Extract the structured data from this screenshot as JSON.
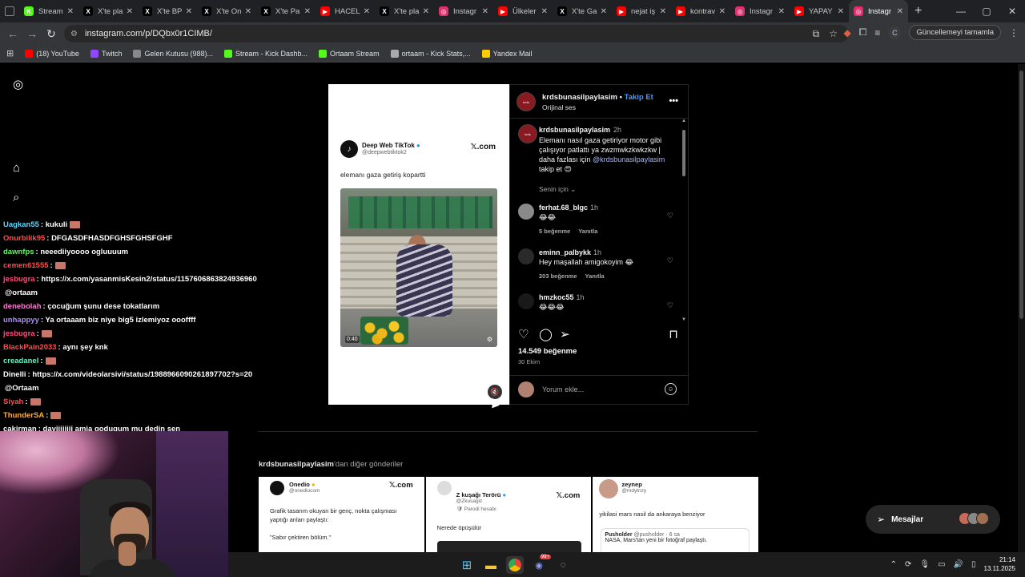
{
  "browser": {
    "tabs": [
      {
        "label": "Stream",
        "color": "#53fc18",
        "glyph": "K"
      },
      {
        "label": "X'te pla",
        "color": "#000000",
        "glyph": "X"
      },
      {
        "label": "X'te BP",
        "color": "#000000",
        "glyph": "X"
      },
      {
        "label": "X'te On",
        "color": "#000000",
        "glyph": "X"
      },
      {
        "label": "X'te Pa",
        "color": "#000000",
        "glyph": "X"
      },
      {
        "label": "HACEL",
        "color": "#ff0000",
        "glyph": "▶"
      },
      {
        "label": "X'te pla",
        "color": "#000000",
        "glyph": "X"
      },
      {
        "label": "Instagr",
        "color": "#e1306c",
        "glyph": "◎"
      },
      {
        "label": "Ülkeler",
        "color": "#ff0000",
        "glyph": "▶"
      },
      {
        "label": "X'te Ga",
        "color": "#000000",
        "glyph": "X"
      },
      {
        "label": "nejat iş",
        "color": "#ff0000",
        "glyph": "▶"
      },
      {
        "label": "kontrav",
        "color": "#ff0000",
        "glyph": "▶"
      },
      {
        "label": "Instagr",
        "color": "#e1306c",
        "glyph": "◎"
      },
      {
        "label": "YAPAY",
        "color": "#ff0000",
        "glyph": "▶"
      },
      {
        "label": "Instagr",
        "color": "#e1306c",
        "glyph": "◎",
        "active": true
      }
    ],
    "url": "instagram.com/p/DQbx0r1CIMB/",
    "update_label": "Güncellemeyi tamamla",
    "profile_initial": "C",
    "bookmarks": [
      {
        "label": "(18) YouTube",
        "color": "#ff0000"
      },
      {
        "label": "Twitch",
        "color": "#9146ff"
      },
      {
        "label": "Gelen Kutusu (988)...",
        "color": "#888888"
      },
      {
        "label": "Stream - Kick Dashb...",
        "color": "#53fc18"
      },
      {
        "label": "Ortaam Stream",
        "color": "#53fc18"
      },
      {
        "label": "ortaam - Kick Stats,...",
        "color": "#aaaaaa"
      },
      {
        "label": "Yandex Mail",
        "color": "#ffcc00"
      }
    ]
  },
  "chat": [
    {
      "user": "Uagkan55",
      "color": "#5dd8ff",
      "msg": ": kukuli",
      "emote": true
    },
    {
      "user": "Onurbilik95",
      "color": "#ff4b4b",
      "msg": ": DFGASDFHASDFGHSFGHSFGHF",
      "emote": false
    },
    {
      "user": "dawnfps",
      "color": "#6ef26e",
      "msg": ": neeediiyoooo ogluuuum",
      "emote": false
    },
    {
      "user": "cemen61555",
      "color": "#ff4b4b",
      "msg": ":",
      "emote": true
    },
    {
      "user": "jesbugra",
      "color": "#ff4b7d",
      "msg": ": https://x.com/yasanmisKesin2/status/1157606863824936960",
      "emote": false
    },
    {
      "user": "",
      "color": "#ffffff",
      "msg": "@ortaam",
      "emote": false
    },
    {
      "user": "denebolah",
      "color": "#ff7bd5",
      "msg": ": çocuğum şunu dese tokatlarım",
      "emote": false
    },
    {
      "user": "unhappyy",
      "color": "#b18cff",
      "msg": ": Ya ortaaam biz niye big5 izlemiyoz oooffff",
      "emote": false
    },
    {
      "user": "jesbugra",
      "color": "#ff4b7d",
      "msg": ":",
      "emote": true
    },
    {
      "user": "BlackPain2033",
      "color": "#ff4b4b",
      "msg": ": aynı şey knk",
      "emote": false
    },
    {
      "user": "creadanel",
      "color": "#6ef2c8",
      "msg": ":",
      "emote": true
    },
    {
      "user": "Dinelli",
      "color": "#ffffff",
      "msg": ": https://x.com/videolarsivi/status/1988966090261897702?s=20",
      "emote": false
    },
    {
      "user": "",
      "color": "#ffffff",
      "msg": "@Ortaam",
      "emote": false
    },
    {
      "user": "Siyah",
      "color": "#ff4b4b",
      "msg": ":",
      "emote": true
    },
    {
      "user": "ThunderSA",
      "color": "#ffb03a",
      "msg": ":",
      "emote": true
    },
    {
      "user": "cakirman",
      "color": "#ffffff",
      "msg": ": dayiiiiiiii amia godugum mu dedin sen",
      "emote": false
    }
  ],
  "video": {
    "tweet_name": "Deep Web TikTok",
    "tweet_handle": "@deepwebtiktok2",
    "tweet_source": "𝕏.com",
    "tweet_text": "elemanı gaza getiriş kopartti",
    "duration": "0:40"
  },
  "post": {
    "account": "krdsbunasilpaylasim",
    "follow_label": "Takip Et",
    "separator": " • ",
    "audio": "Orijinal ses",
    "caption_time": "2h",
    "caption_lines": [
      "Elemanı nasıl gaza getiriyor motor gibi",
      "çalışıyor patlattı ya zwzmwkzkwkzkw |",
      "daha fazlası için "
    ],
    "caption_mention": "@krdsbunasilpaylasim",
    "caption_end": "takip et 😍",
    "for_you": "Senin için",
    "comments": [
      {
        "user": "ferhat.68_blgc",
        "time": "1h",
        "text": "😂😂",
        "likes": "5 beğenme",
        "reply": "Yanıtla"
      },
      {
        "user": "eminn_palbykk",
        "time": "1h",
        "text": "Hey maşallah amigokoyim 😂",
        "likes": "203 beğenme",
        "reply": "Yanıtla"
      },
      {
        "user": "hmzkoc55",
        "time": "1h",
        "text": "😂😂😂",
        "likes": "",
        "reply": ""
      }
    ],
    "like_count": "14.549 beğenme",
    "date": "30 Ekim",
    "comment_placeholder": "Yorum ekle..."
  },
  "more_posts": {
    "title_suffix": "'dan diğer gönderiler",
    "cards": [
      {
        "name": "Onedio",
        "handle": "@onediocom",
        "source": "𝕏.com",
        "text": "Grafik tasarım okuyan bir genç, nokta çalışması yaptığı anları paylaştı:",
        "text2": "\"Sabır çektiren bölüm.\""
      },
      {
        "name": "Z kuşağı Terörü",
        "handle": "@Zkusagiz",
        "source": "𝕏.com",
        "sub": "Parodi hesabı",
        "text": "Nerede öpüşülür"
      },
      {
        "name": "zeynep",
        "handle": "@mdytnzy",
        "text": "yikilasi mars nasil da ankaraya benziyor",
        "quote_name": "Pusholder",
        "quote_handle": "@pusholder · 6 sa",
        "quote_text": "NASA, Mars'tan yeni bir fotoğraf paylaştı."
      }
    ]
  },
  "messages_label": "Mesajlar",
  "clock": {
    "time": "21:14",
    "date": "13.11.2025"
  },
  "taskbar_badge": "99+"
}
